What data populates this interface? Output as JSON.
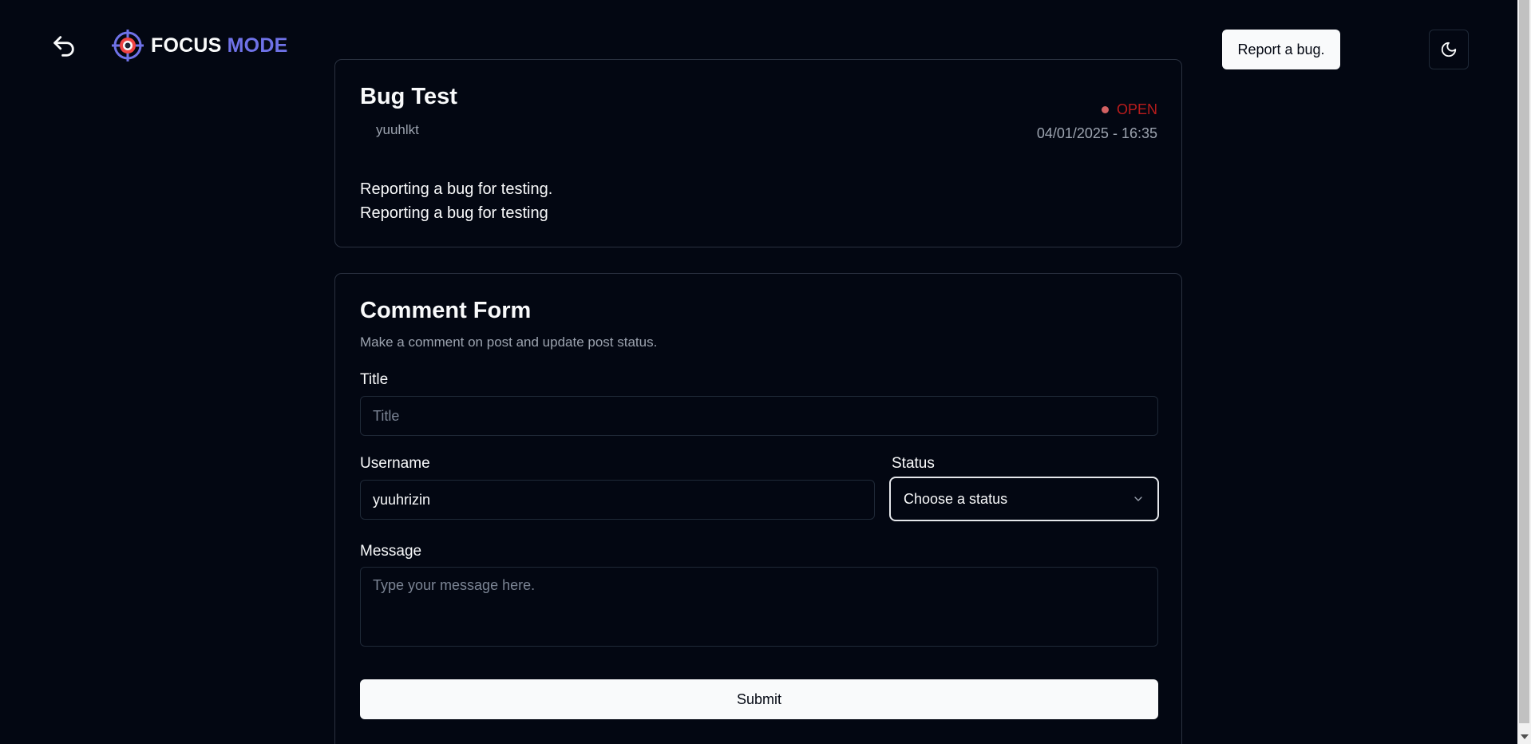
{
  "header": {
    "logo_word1": "FOCUS",
    "logo_word2": "MODE",
    "report_bug_label": "Report a bug.",
    "icons": {
      "back": "undo-arrow-icon",
      "logo": "target-crosshair-icon",
      "theme": "moon-icon"
    }
  },
  "post": {
    "title": "Bug Test",
    "author": "yuuhlkt",
    "status": "OPEN",
    "date": "04/01/2025 - 16:35",
    "body_lines": [
      "Reporting a bug for testing.",
      "Reporting a bug for testing"
    ]
  },
  "form": {
    "title": "Comment Form",
    "description": "Make a comment on post and update post status.",
    "title_label": "Title",
    "title_placeholder": "Title",
    "title_value": "",
    "username_label": "Username",
    "username_value": "yuuhrizin",
    "status_label": "Status",
    "status_selected": "Choose a status",
    "message_label": "Message",
    "message_placeholder": "Type your message here.",
    "submit_label": "Submit"
  },
  "colors": {
    "background": "#030712",
    "accent": "#6f72e8",
    "status_open": "#b91c1c",
    "border": "#2a3140"
  }
}
